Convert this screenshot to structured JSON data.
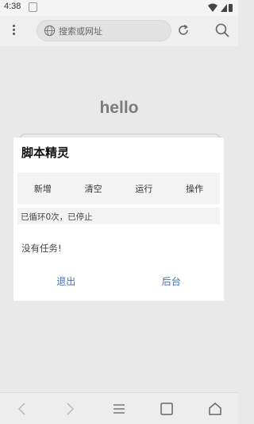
{
  "status_bar": {
    "time": "4:38"
  },
  "browser": {
    "address_placeholder": "搜索或网址",
    "page_heading": "hello"
  },
  "dialog": {
    "title": "脚本精灵",
    "toolbar": [
      {
        "label": "新增"
      },
      {
        "label": "清空"
      },
      {
        "label": "运行"
      },
      {
        "label": "操作"
      }
    ],
    "status_text": "已循环0次，已停止",
    "empty_text": "没有任务!",
    "actions": [
      {
        "label": "退出"
      },
      {
        "label": "后台"
      }
    ]
  },
  "colors": {
    "action_text": "#4a6fb0",
    "overlay_bg": "#e9e9e9"
  },
  "icons": {
    "top_bar": [
      "menu-icon",
      "globe-icon",
      "refresh-icon",
      "search-icon"
    ],
    "bottom_nav": [
      "back-icon",
      "forward-icon",
      "menu-lines-icon",
      "tabs-icon",
      "home-icon"
    ]
  }
}
